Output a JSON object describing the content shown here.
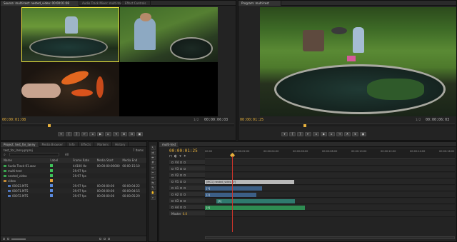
{
  "source_monitor": {
    "tab_label": "Source: multi-test: nested_video: 00:00:01:08",
    "tab2_label": "Audio Track Mixer: multi-test",
    "tab3_label": "Effect Controls",
    "timecode_left": "00:00:01:08",
    "zoom": "Fit",
    "fraction": "1/2",
    "timecode_right": "00:00:06:03"
  },
  "program_monitor": {
    "tab_label": "Program: multi-test",
    "timecode_left": "00:00:01:25",
    "zoom": "Fit",
    "fraction": "1/2",
    "timecode_right": "00:00:06:03"
  },
  "project_panel": {
    "tabs": [
      "Project: test_for_lanny",
      "Media Browser",
      "Info",
      "Effects",
      "Markers",
      "History"
    ],
    "project_file": "test_for_lanny.prproj",
    "item_count": "7 Items",
    "search_in": "All",
    "columns": [
      "Name",
      "Label",
      "Frame Rate",
      "Media Start",
      "Media End"
    ],
    "rows": [
      {
        "name": "Audio Track-01.wav",
        "color": "#3fc45a",
        "rate": "44100 Hz",
        "start": "00:00:00:00000",
        "end": "00:00:15:10"
      },
      {
        "name": "multi-test",
        "color": "#3fc45a",
        "rate": "29.97 fps",
        "start": "",
        "end": ""
      },
      {
        "name": "nested_video",
        "color": "#3fc45a",
        "rate": "29.97 fps",
        "start": "",
        "end": ""
      },
      {
        "name": "video",
        "color": "#e8a43a",
        "rate": "",
        "start": "",
        "end": ""
      },
      {
        "name": "00023.MTS",
        "color": "#5b8be0",
        "rate": "29.97 fps",
        "start": "00:00:00:00",
        "end": "00:00:04:22"
      },
      {
        "name": "00071.MTS",
        "color": "#5b8be0",
        "rate": "29.97 fps",
        "start": "00:00:00:00",
        "end": "00:00:04:15"
      },
      {
        "name": "00072.MTS",
        "color": "#5b8be0",
        "rate": "29.97 fps",
        "start": "00:00:00:00",
        "end": "00:00:05:29"
      }
    ]
  },
  "timeline": {
    "tab_label": "multi-test",
    "timecode": "00:00:01:25",
    "ruler_labels": [
      "00:00",
      "00:00:02:00",
      "00:00:04:00",
      "00:00:06:00",
      "00:00:08:00",
      "00:00:10:00",
      "00:00:12:00",
      "00:00:14:00",
      "00:00:16:00"
    ],
    "video_tracks": [
      "V4",
      "V3",
      "V2",
      "V1"
    ],
    "audio_tracks": [
      "A1",
      "A2",
      "A3",
      "A4"
    ],
    "master_label": "Master",
    "master_value": "0.0",
    "v1_clip": "[MC1] nested_video [V]",
    "audio_clip_labels": [
      "[1]",
      "[2]",
      "[3]",
      "[4]"
    ],
    "colors": {
      "video_clip": "#b9b9b9",
      "audio_blue": "#3c5f86",
      "audio_teal": "#2f7a6e",
      "audio_green": "#2e8c52",
      "playhead": "#d0352b",
      "timecode": "#e6b03c"
    }
  }
}
